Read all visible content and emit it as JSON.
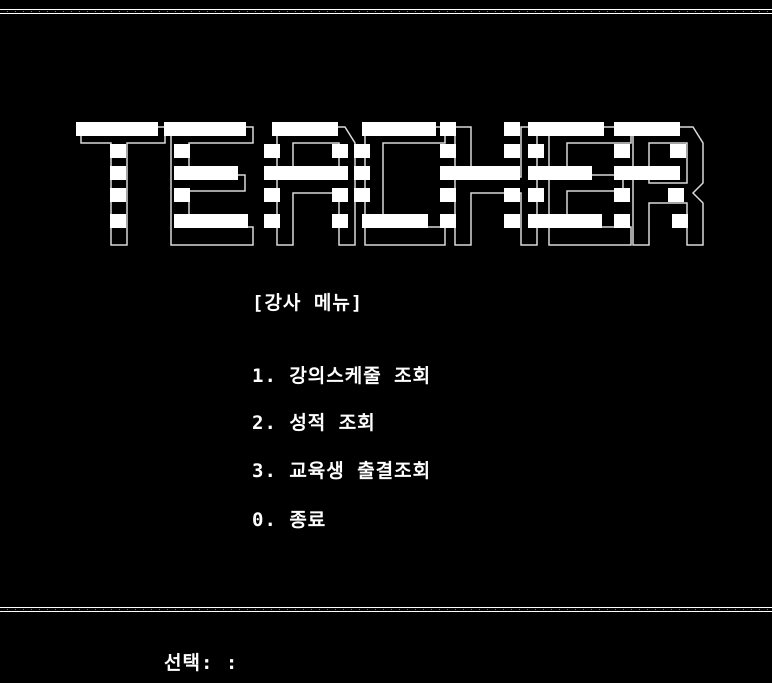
{
  "window": {
    "background": "#000000",
    "foreground": "#ffffff"
  },
  "banner": {
    "text": "TEACHER"
  },
  "menu": {
    "title": "[강사 메뉴]",
    "items": [
      {
        "key": "1",
        "label": "1. 강의스케줄 조회"
      },
      {
        "key": "2",
        "label": "2. 성적 조회"
      },
      {
        "key": "3",
        "label": "3. 교육생 출결조회"
      },
      {
        "key": "0",
        "label": "0. 종료"
      }
    ]
  },
  "prompt": {
    "label": "선택: :",
    "value": ""
  }
}
